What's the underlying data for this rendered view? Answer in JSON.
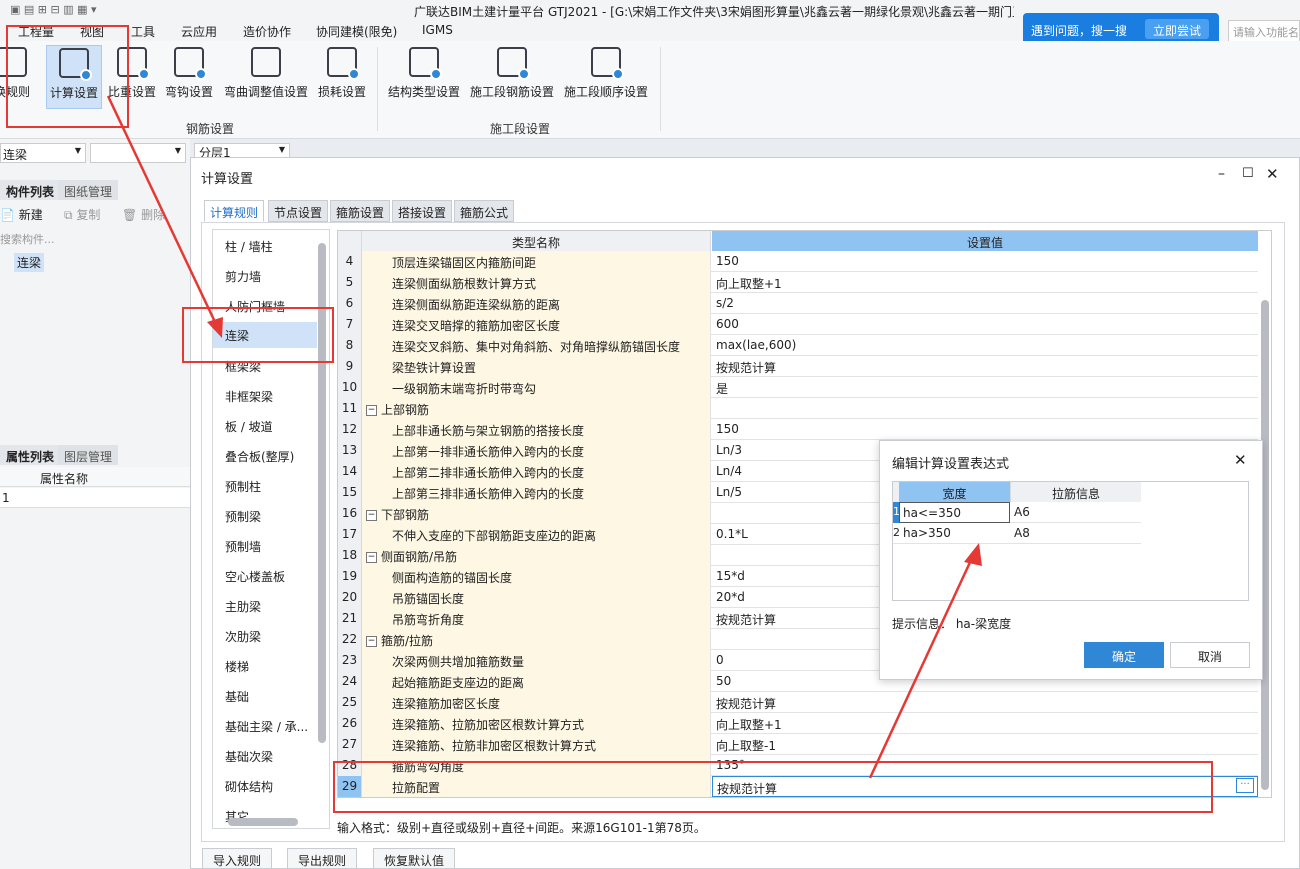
{
  "window_title": "广联达BIM土建计量平台 GTJ2021 - [G:\\宋娟工作文件夹\\3宋娟图形算量\\兆鑫云著一期绿化景观\\兆鑫云著一期门卫亭.GTJ]",
  "menu": [
    "工程量",
    "视图",
    "工具",
    "云应用",
    "造价协作",
    "协同建模(限免)",
    "IGMS"
  ],
  "help": {
    "text": "遇到问题，搜一搜",
    "button": "立即尝试",
    "search_placeholder": "请输入功能名"
  },
  "ribbon": {
    "buttons": [
      {
        "label": "换规则"
      },
      {
        "label": "计算设置"
      },
      {
        "label": "比重设置"
      },
      {
        "label": "弯钩设置"
      },
      {
        "label": "弯曲调整值设置"
      },
      {
        "label": "损耗设置"
      },
      {
        "label": "结构类型设置"
      },
      {
        "label": "施工段钢筋设置"
      },
      {
        "label": "施工段顺序设置"
      }
    ],
    "group1": "钢筋设置",
    "group2": "施工段设置"
  },
  "left": {
    "combo1": "连梁",
    "combo2": "",
    "floor": "分层1",
    "tabs1": [
      "构件列表",
      "图纸管理"
    ],
    "new_label": "新建",
    "copy_label": "复制",
    "delete_label": "删除",
    "search_placeholder": "搜索构件...",
    "component": "连梁",
    "tabs2": [
      "属性列表",
      "图层管理"
    ],
    "prop_header": "属性名称",
    "prop_row": "1"
  },
  "dialog": {
    "title": "计算设置",
    "tabs": [
      "计算规则",
      "节点设置",
      "箍筋设置",
      "搭接设置",
      "箍筋公式"
    ],
    "categories": [
      "柱 / 墙柱",
      "剪力墙",
      "人防门框墙",
      "连梁",
      "框架梁",
      "非框架梁",
      "板 / 坡道",
      "叠合板(整厚)",
      "预制柱",
      "预制梁",
      "预制墙",
      "空心楼盖板",
      "主肋梁",
      "次肋梁",
      "楼梯",
      "基础",
      "基础主梁 / 承...",
      "基础次梁",
      "砌体结构",
      "其它"
    ],
    "col_name": "类型名称",
    "col_value": "设置值",
    "rows": [
      {
        "n": "4",
        "name": "顶层连梁锚固区内箍筋间距",
        "value": "150",
        "lvl": 1
      },
      {
        "n": "5",
        "name": "连梁侧面纵筋根数计算方式",
        "value": "向上取整+1",
        "lvl": 1
      },
      {
        "n": "6",
        "name": "连梁侧面纵筋距连梁纵筋的距离",
        "value": "s/2",
        "lvl": 1
      },
      {
        "n": "7",
        "name": "连梁交叉暗撑的箍筋加密区长度",
        "value": "600",
        "lvl": 1
      },
      {
        "n": "8",
        "name": "连梁交叉斜筋、集中对角斜筋、对角暗撑纵筋锚固长度",
        "value": "max(lae,600)",
        "lvl": 1
      },
      {
        "n": "9",
        "name": "梁垫铁计算设置",
        "value": "按规范计算",
        "lvl": 1
      },
      {
        "n": "10",
        "name": "一级钢筋末端弯折时带弯勾",
        "value": "是",
        "lvl": 1
      },
      {
        "n": "11",
        "name": "上部钢筋",
        "value": "",
        "lvl": 0
      },
      {
        "n": "12",
        "name": "上部非通长筋与架立钢筋的搭接长度",
        "value": "150",
        "lvl": 1
      },
      {
        "n": "13",
        "name": "上部第一排非通长筋伸入跨内的长度",
        "value": "Ln/3",
        "lvl": 1
      },
      {
        "n": "14",
        "name": "上部第二排非通长筋伸入跨内的长度",
        "value": "Ln/4",
        "lvl": 1
      },
      {
        "n": "15",
        "name": "上部第三排非通长筋伸入跨内的长度",
        "value": "Ln/5",
        "lvl": 1
      },
      {
        "n": "16",
        "name": "下部钢筋",
        "value": "",
        "lvl": 0
      },
      {
        "n": "17",
        "name": "不伸入支座的下部钢筋距支座边的距离",
        "value": "0.1*L",
        "lvl": 1
      },
      {
        "n": "18",
        "name": "侧面钢筋/吊筋",
        "value": "",
        "lvl": 0
      },
      {
        "n": "19",
        "name": "侧面构造筋的锚固长度",
        "value": "15*d",
        "lvl": 1
      },
      {
        "n": "20",
        "name": "吊筋锚固长度",
        "value": "20*d",
        "lvl": 1
      },
      {
        "n": "21",
        "name": "吊筋弯折角度",
        "value": "按规范计算",
        "lvl": 1
      },
      {
        "n": "22",
        "name": "箍筋/拉筋",
        "value": "",
        "lvl": 0
      },
      {
        "n": "23",
        "name": "次梁两侧共增加箍筋数量",
        "value": "0",
        "lvl": 1
      },
      {
        "n": "24",
        "name": "起始箍筋距支座边的距离",
        "value": "50",
        "lvl": 1
      },
      {
        "n": "25",
        "name": "连梁箍筋加密区长度",
        "value": "按规范计算",
        "lvl": 1
      },
      {
        "n": "26",
        "name": "连梁箍筋、拉筋加密区根数计算方式",
        "value": "向上取整+1",
        "lvl": 1
      },
      {
        "n": "27",
        "name": "连梁箍筋、拉筋非加密区根数计算方式",
        "value": "向上取整-1",
        "lvl": 1
      },
      {
        "n": "28",
        "name": "箍筋弯勾角度",
        "value": "135°",
        "lvl": 1
      },
      {
        "n": "29",
        "name": "拉筋配置",
        "value": "按规范计算",
        "lvl": 1
      }
    ],
    "hint": "输入格式：级别+直径或级别+直径+间距。来源16G101-1第78页。",
    "bottom_buttons": [
      "导入规则",
      "导出规则",
      "恢复默认值"
    ]
  },
  "popup": {
    "title": "编辑计算设置表达式",
    "col1": "宽度",
    "col2": "拉筋信息",
    "rows": [
      {
        "n": "1",
        "w": "ha<=350",
        "info": "A6"
      },
      {
        "n": "2",
        "w": "ha>350",
        "info": "A8"
      }
    ],
    "hint": "提示信息： ha-梁宽度",
    "ok": "确定",
    "cancel": "取消"
  }
}
